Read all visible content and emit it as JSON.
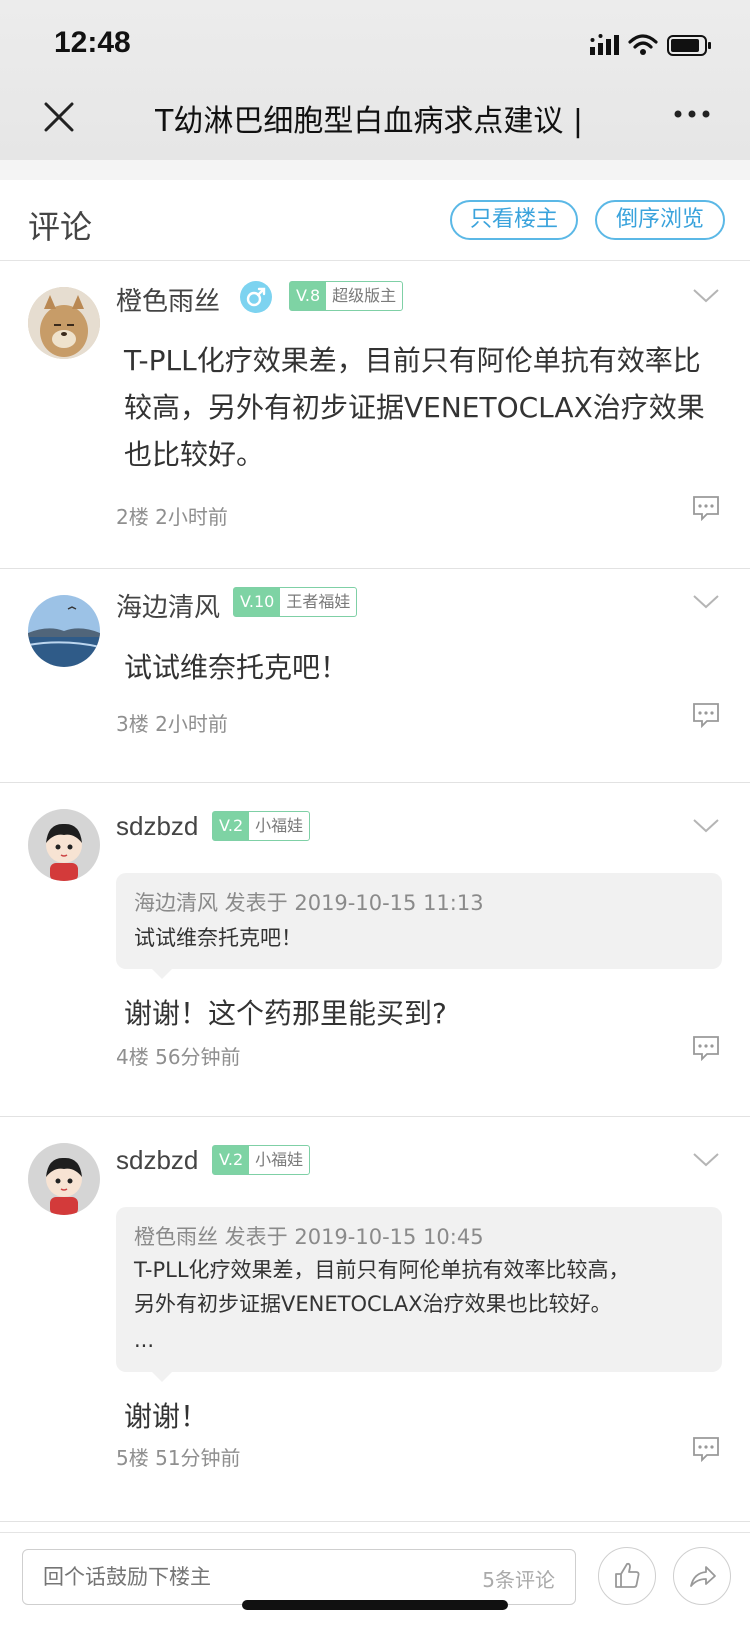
{
  "status_bar": {
    "time": "12:48"
  },
  "nav": {
    "title": "T幼淋巴细胞型白血病求点建议 |"
  },
  "comments_header": {
    "title": "评论",
    "filter_owner_label": "只看楼主",
    "reverse_label": "倒序浏览"
  },
  "comments": [
    {
      "username": "橙色雨丝",
      "level": "V.8",
      "title": "超级版主",
      "text": "T-PLL化疗效果差，目前只有阿伦单抗有效率比较高，另外有初步证据VENETOCLAX治疗效果也比较好。",
      "floor": "2楼",
      "time": "2小时前"
    },
    {
      "username": "海边清风",
      "level": "V.10",
      "title": "王者福娃",
      "text": "试试维奈托克吧！",
      "floor": "3楼",
      "time": "2小时前"
    },
    {
      "username": "sdzbzd",
      "level": "V.2",
      "title": "小福娃",
      "quote_header": "海边清风 发表于 2019-10-15 11:13",
      "quote_text": "试试维奈托克吧！",
      "text": "谢谢！这个药那里能买到?",
      "floor": "4楼",
      "time": "56分钟前"
    },
    {
      "username": "sdzbzd",
      "level": "V.2",
      "title": "小福娃",
      "quote_header": "橙色雨丝 发表于 2019-10-15 10:45",
      "quote_line1": "T-PLL化疗效果差，目前只有阿伦单抗有效率比较高，",
      "quote_line2": "另外有初步证据VENETOCLAX治疗效果也比较好。",
      "quote_line3": "...",
      "text": "谢谢！",
      "floor": "5楼",
      "time": "51分钟前"
    }
  ],
  "bottom_bar": {
    "placeholder": "回个话鼓励下楼主",
    "comment_count": "5条评论"
  },
  "colors": {
    "accent": "#3aa3dc",
    "level_green": "#7ed3a4",
    "gender_blue": "#7dd3f0"
  }
}
